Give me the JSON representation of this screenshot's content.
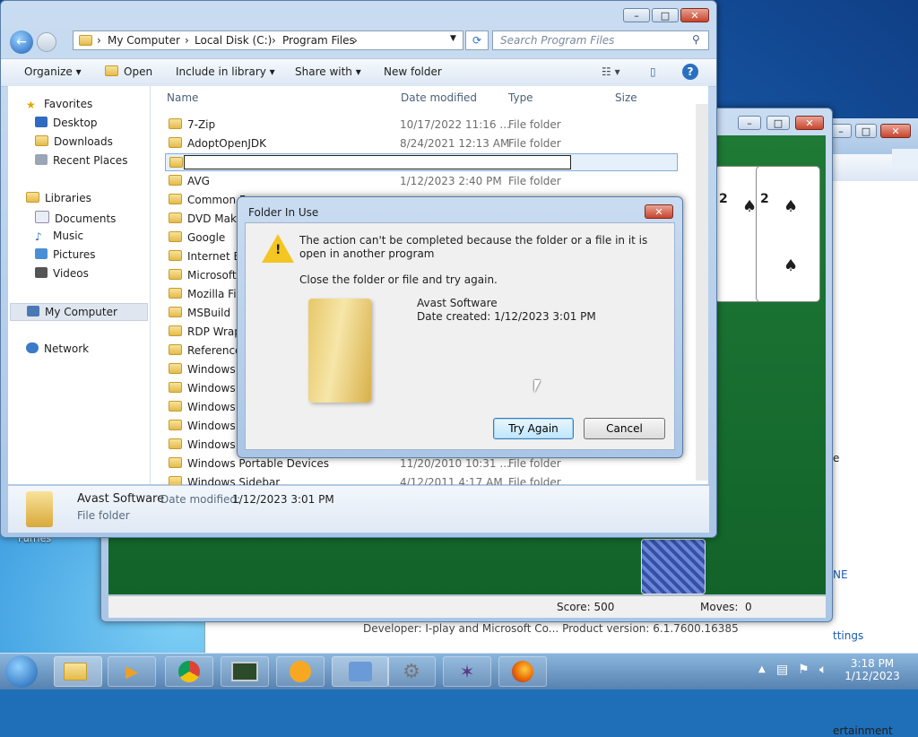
{
  "desktop": {
    "icon_label": "Furries"
  },
  "game_window": {
    "card_rank_a": "2",
    "card_rank_b": "2",
    "score": "Score: 500",
    "moves_label": "Moves:",
    "moves_value": "0"
  },
  "games_explorer": {
    "link1": "NE",
    "link2": "ttings",
    "label1": "e",
    "label2": "ertainment",
    "developer_label": "Developer:",
    "developer_value": "I-play and Microsoft Co...",
    "product_version_label": "Product version:",
    "product_version_value": "6.1.7600.16385"
  },
  "explorer": {
    "breadcrumb": [
      "My Computer",
      "Local Disk (C:)",
      "Program Files"
    ],
    "search_placeholder": "Search Program Files",
    "toolbar": {
      "organize": "Organize",
      "open": "Open",
      "include_in_library": "Include in library",
      "share_with": "Share with",
      "new_folder": "New folder"
    },
    "nav": {
      "favorites": "Favorites",
      "desktop": "Desktop",
      "downloads": "Downloads",
      "recent_places": "Recent Places",
      "libraries": "Libraries",
      "documents": "Documents",
      "music": "Music",
      "pictures": "Pictures",
      "videos": "Videos",
      "my_computer": "My Computer",
      "network": "Network"
    },
    "columns": {
      "name": "Name",
      "date_modified": "Date modified",
      "type": "Type",
      "size": "Size"
    },
    "rows": [
      {
        "name": "7-Zip",
        "date": "10/17/2022 11:16 ...",
        "type": "File folder"
      },
      {
        "name": "AdoptOpenJDK",
        "date": "8/24/2021 12:13 AM",
        "type": "File folder"
      },
      {
        "name": "",
        "date": "",
        "type": ""
      },
      {
        "name": "AVG",
        "date": "1/12/2023 2:40 PM",
        "type": "File folder"
      },
      {
        "name": "Common F",
        "date": "",
        "type": ""
      },
      {
        "name": "DVD Maker",
        "date": "",
        "type": ""
      },
      {
        "name": "Google",
        "date": "",
        "type": ""
      },
      {
        "name": "Internet Exp",
        "date": "",
        "type": ""
      },
      {
        "name": "Microsoft G",
        "date": "",
        "type": ""
      },
      {
        "name": "Mozilla Fire",
        "date": "",
        "type": ""
      },
      {
        "name": "MSBuild",
        "date": "",
        "type": ""
      },
      {
        "name": "RDP Wrapp",
        "date": "",
        "type": ""
      },
      {
        "name": "Reference A",
        "date": "",
        "type": ""
      },
      {
        "name": "Windows D",
        "date": "",
        "type": ""
      },
      {
        "name": "Windows M",
        "date": "",
        "type": ""
      },
      {
        "name": "Windows M",
        "date": "",
        "type": ""
      },
      {
        "name": "Windows N",
        "date": "",
        "type": ""
      },
      {
        "name": "Windows P",
        "date": "",
        "type": ""
      },
      {
        "name": "Windows Portable Devices",
        "date": "11/20/2010 10:31 ...",
        "type": "File folder"
      },
      {
        "name": "Windows Sidebar",
        "date": "4/12/2011 4:17 AM",
        "type": "File folder"
      }
    ],
    "rename_value": "",
    "details": {
      "name": "Avast Software",
      "date_label": "Date modified:",
      "date_value": "1/12/2023 3:01 PM",
      "kind": "File folder"
    }
  },
  "dialog": {
    "title": "Folder In Use",
    "message": "The action can't be completed because the folder or a file in it is open in another program",
    "instruction": "Close the folder or file and try again.",
    "item_name": "Avast Software",
    "item_date": "Date created: 1/12/2023 3:01 PM",
    "try_again": "Try Again",
    "cancel": "Cancel"
  },
  "taskbar": {
    "clock_time": "3:18 PM",
    "clock_date": "1/12/2023"
  }
}
